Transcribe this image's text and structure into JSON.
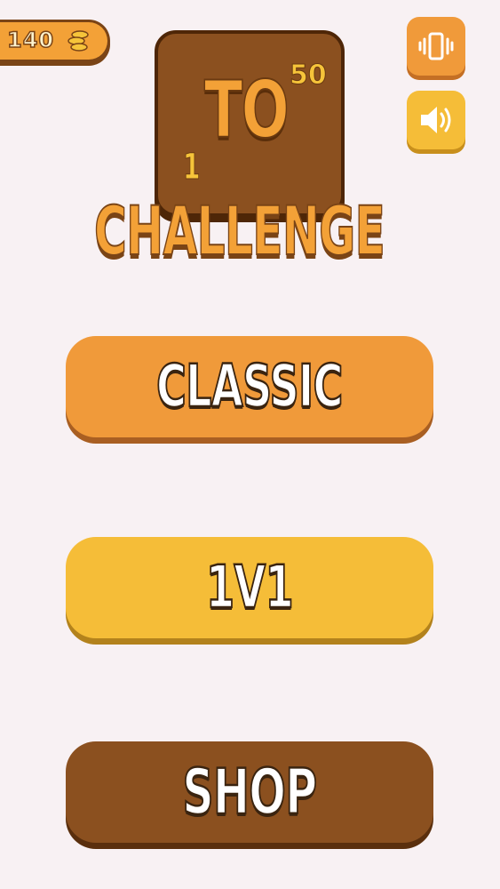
{
  "hud": {
    "coins": "140",
    "coin_icon": "coin-stack-icon"
  },
  "logo": {
    "small_one": "1",
    "to": "TO",
    "small_fifty": "50",
    "challenge": "CHALLENGE"
  },
  "controls": {
    "vibrate_icon": "vibrate-icon",
    "sound_icon": "speaker-icon"
  },
  "menu": {
    "classic": "CLASSIC",
    "versus": "1V1",
    "shop": "SHOP"
  },
  "colors": {
    "background": "#f8f1f3",
    "orange": "#f09a3a",
    "yellow": "#f5bd38",
    "brown": "#8b501f",
    "dark_brown": "#4e2607"
  }
}
